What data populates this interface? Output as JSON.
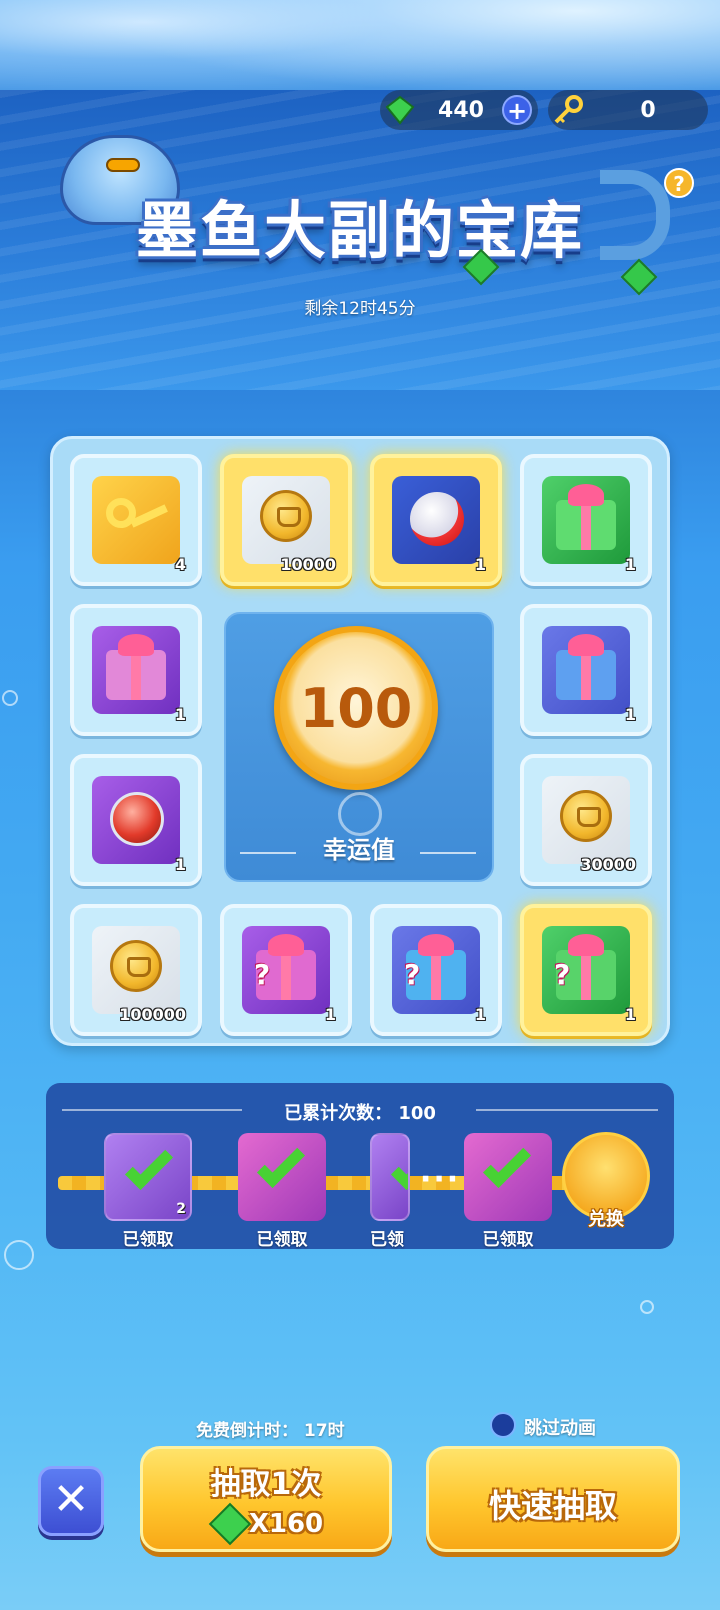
{
  "header": {
    "gems": "440",
    "keys": "0",
    "plus_label": "+",
    "help_label": "?"
  },
  "event": {
    "title": "墨鱼大副的宝库",
    "time_left": "剩余12时45分"
  },
  "grid": {
    "cells": [
      {
        "reward": "key",
        "count": "4"
      },
      {
        "reward": "coin",
        "count": "10000"
      },
      {
        "reward": "ball",
        "count": "1"
      },
      {
        "reward": "gift-green",
        "count": "1"
      },
      {
        "reward": "gift-purple",
        "count": "1"
      },
      {
        "reward": "gift-blue",
        "count": "1"
      },
      {
        "reward": "ball-red",
        "count": "1"
      },
      {
        "reward": "coin",
        "count": "30000"
      },
      {
        "reward": "coin",
        "count": "100000"
      },
      {
        "reward": "mystery-gift-purple",
        "count": "1"
      },
      {
        "reward": "mystery-gift-blue",
        "count": "1"
      },
      {
        "reward": "mystery-gift-green",
        "count": "1"
      }
    ],
    "highlighted": [
      1,
      2,
      11
    ]
  },
  "lucky": {
    "value": "100",
    "label": "幸运值"
  },
  "progress": {
    "title": "已累计次数： 100",
    "milestones": [
      {
        "status": "已领取",
        "count": "2"
      },
      {
        "status": "已领取",
        "count": ""
      },
      {
        "status": "已领",
        "count": ""
      },
      {
        "status": "已领取",
        "count": ""
      }
    ],
    "ellipsis": "···",
    "exchange_label": "兑换"
  },
  "controls": {
    "free_countdown": "免费倒计时： 17时",
    "skip_animation": "跳过动画",
    "close_label": "✕",
    "draw_once": "抽取1次",
    "draw_cost": "X160",
    "quick_draw": "快速抽取"
  },
  "colors": {
    "highlight": "#ffe06a",
    "button_gold": "#ffc62d",
    "close_blue": "#4a62e0",
    "gem_green": "#3dd04e"
  }
}
